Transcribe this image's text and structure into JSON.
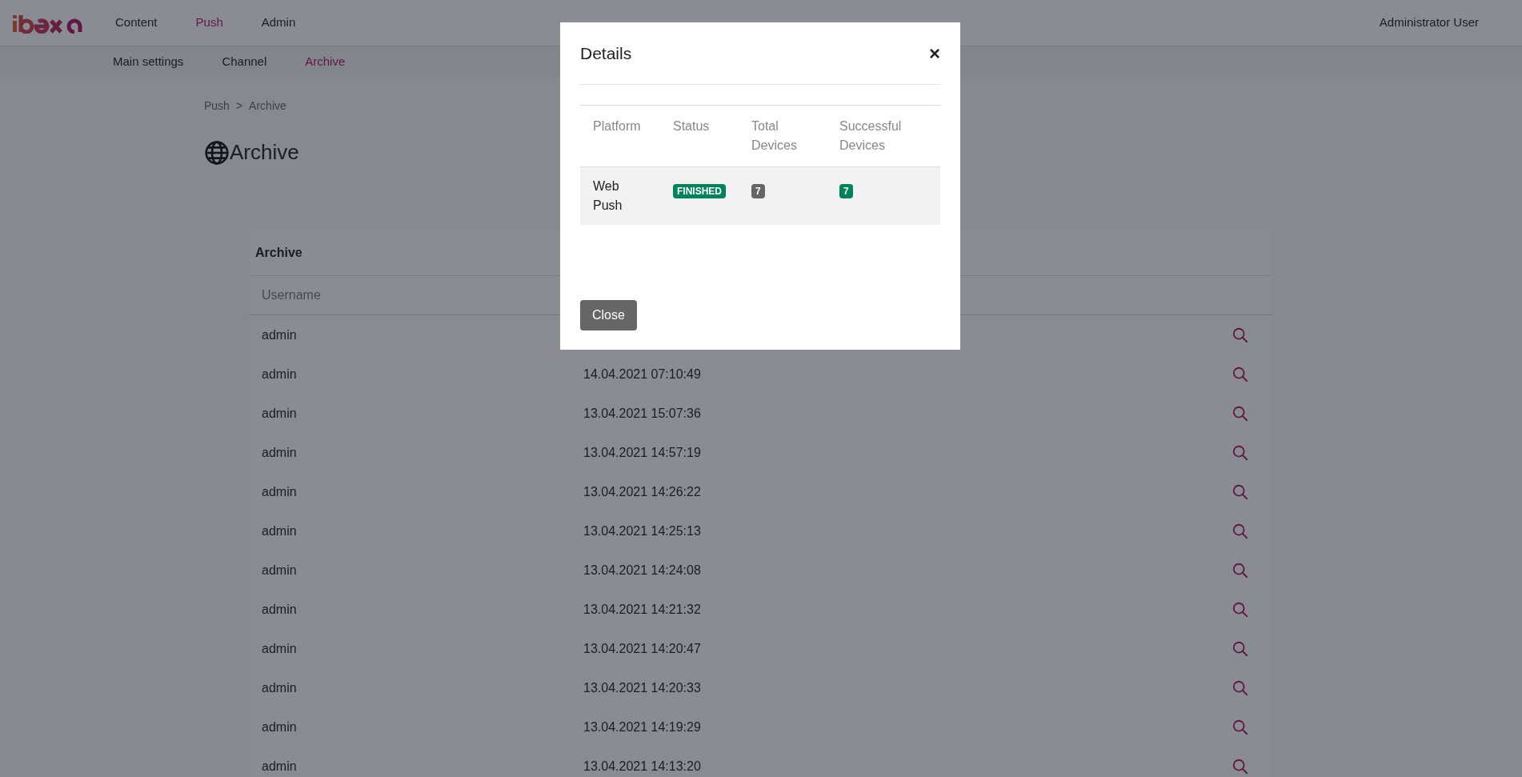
{
  "header": {
    "nav": [
      {
        "label": "Content",
        "selected": false
      },
      {
        "label": "Push",
        "selected": true
      },
      {
        "label": "Admin",
        "selected": false
      }
    ],
    "user": "Administrator User"
  },
  "subnav": [
    {
      "label": "Main settings",
      "selected": false
    },
    {
      "label": "Channel",
      "selected": false
    },
    {
      "label": "Archive",
      "selected": true
    }
  ],
  "breadcrumb": [
    "Push",
    ">",
    "Archive"
  ],
  "page_title": "Archive",
  "archive": {
    "title": "Archive",
    "columns": [
      "Username"
    ],
    "rows": [
      {
        "username": "admin"
      },
      {
        "username": "admin",
        "date": "14.04.2021 07:10:49"
      },
      {
        "username": "admin",
        "date": "13.04.2021 15:07:36"
      },
      {
        "username": "admin",
        "date": "13.04.2021 14:57:19"
      },
      {
        "username": "admin",
        "date": "13.04.2021 14:26:22"
      },
      {
        "username": "admin",
        "date": "13.04.2021 14:25:13"
      },
      {
        "username": "admin",
        "date": "13.04.2021 14:24:08"
      },
      {
        "username": "admin",
        "date": "13.04.2021 14:21:32"
      },
      {
        "username": "admin",
        "date": "13.04.2021 14:20:47"
      },
      {
        "username": "admin",
        "date": "13.04.2021 14:20:33"
      },
      {
        "username": "admin",
        "date": "13.04.2021 14:19:29"
      },
      {
        "username": "admin",
        "date": "13.04.2021 14:13:20"
      }
    ]
  },
  "modal": {
    "title": "Details",
    "close_icon": "×",
    "columns": [
      "Platform",
      "Status",
      "Total Devices",
      "Successful Devices"
    ],
    "rows": [
      {
        "platform": "Web Push",
        "status": {
          "text": "FINISHED",
          "color": "#00825a"
        },
        "total": {
          "text": "7",
          "color": "#666666"
        },
        "successful": {
          "text": "7",
          "color": "#00825a"
        }
      }
    ],
    "button": "Close"
  }
}
